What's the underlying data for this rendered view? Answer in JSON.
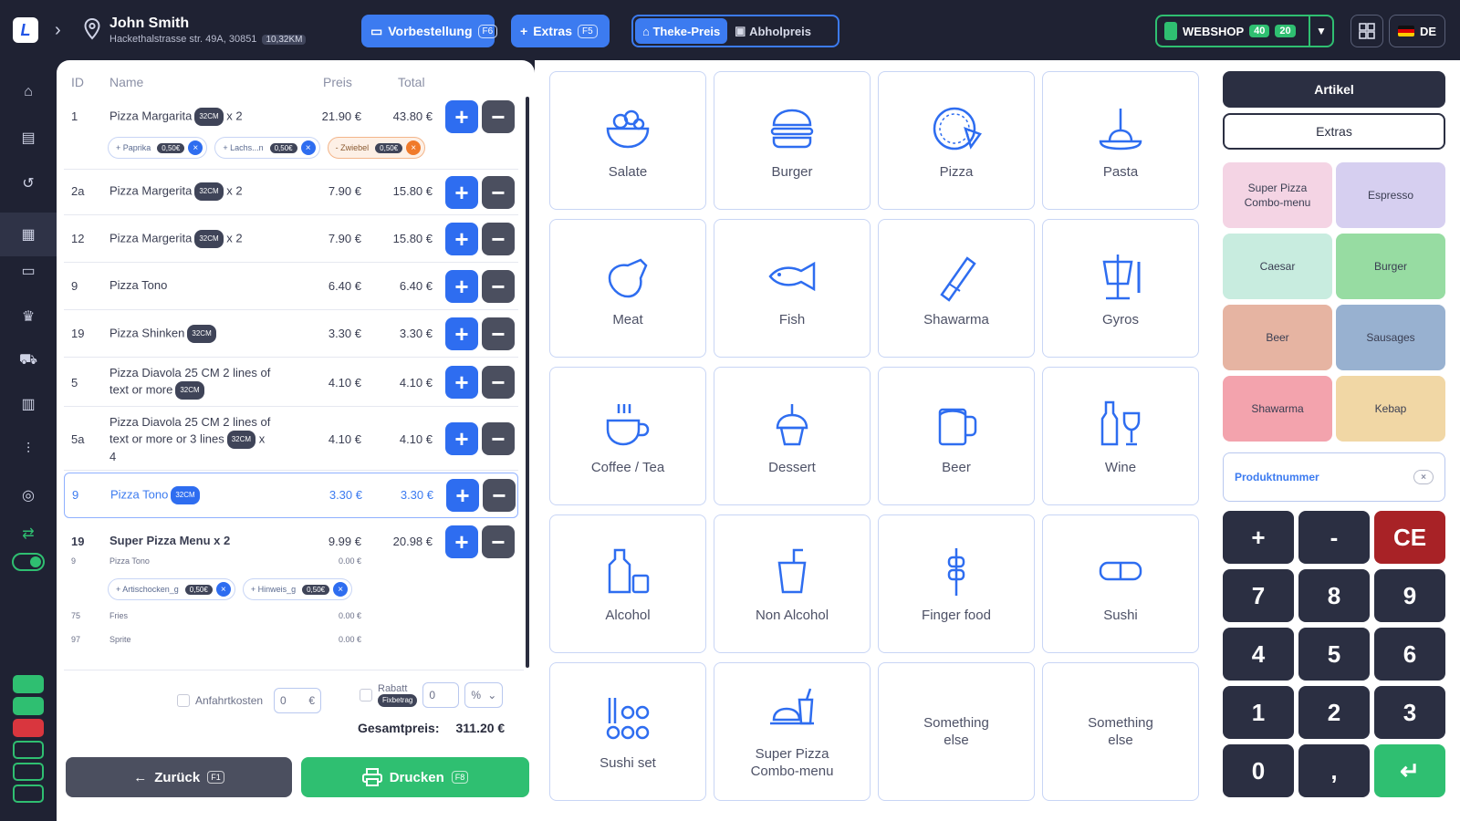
{
  "header": {
    "logo": "L",
    "customer_name": "John Smith",
    "customer_address": "Hackethalstrasse str. 49A, 30851",
    "customer_tag": "10,32KM",
    "btn_vorbestellung": "Vorbestellung",
    "btn_vorbestellung_key": "F6",
    "btn_extras": "Extras",
    "btn_extras_key": "F5",
    "seg_theke": "Theke-Preis",
    "seg_abholpreis": "Abholpreis",
    "webshop_label": "WEBSHOP",
    "webshop_count1": "40",
    "webshop_count2": "20",
    "language": "DE"
  },
  "table": {
    "col_id": "ID",
    "col_name": "Name",
    "col_price": "Preis",
    "col_total": "Total"
  },
  "rows": [
    {
      "id": "1",
      "name": "Pizza Margarita",
      "tag": "32CM",
      "qty": "x 2",
      "price": "21.90 €",
      "total": "43.80 €"
    },
    {
      "id": "2a",
      "name": "Pizza Margerita",
      "tag": "32CM",
      "qty": "x 2",
      "price": "7.90 €",
      "total": "15.80 €"
    },
    {
      "id": "12",
      "name": "Pizza Margerita",
      "tag": "32CM",
      "qty": "x 2",
      "price": "7.90 €",
      "total": "15.80 €"
    },
    {
      "id": "9",
      "name": "Pizza Tono",
      "tag": "",
      "qty": "",
      "price": "6.40 €",
      "total": "6.40 €"
    },
    {
      "id": "19",
      "name": "Pizza Shinken",
      "tag": "32CM",
      "qty": "",
      "price": "3.30 €",
      "total": "3.30 €"
    },
    {
      "id": "5",
      "name": "Pizza Diavola 25 CM 2 lines of text or more",
      "tag": "32CM",
      "qty": "",
      "price": "4.10 €",
      "total": "4.10 €"
    },
    {
      "id": "5a",
      "name": "Pizza Diavola 25 CM 2 lines of text or more or 3 lines",
      "tag": "32CM",
      "qty": "x 4",
      "price": "4.10 €",
      "total": "4.10 €"
    },
    {
      "id": "9",
      "name": "Pizza Tono",
      "tag": "32CM",
      "qty": "",
      "price": "3.30 €",
      "total": "3.30 €"
    },
    {
      "id": "19",
      "name": "Super Pizza Menu x 2",
      "tag": "",
      "qty": "",
      "price": "9.99 €",
      "total": "20.98 €"
    }
  ],
  "row1_chips": [
    {
      "label": "+ Paprika",
      "tag": "0,50€"
    },
    {
      "label": "+ Lachs...n",
      "tag": "0,50€"
    },
    {
      "label": "- Zwiebel",
      "tag": "0,50€"
    }
  ],
  "menu_subitems": [
    {
      "id": "9",
      "name": "Pizza Tono",
      "price": "0.00 €"
    },
    {
      "id": "75",
      "name": "Fries",
      "price": "0.00 €"
    },
    {
      "id": "97",
      "name": "Sprite",
      "price": "0.00 €"
    }
  ],
  "menu_chips": [
    {
      "label": "+ Artischocken_g",
      "tag": "0,50€"
    },
    {
      "label": "+ Hinweis_g",
      "tag": "0,50€"
    }
  ],
  "footer": {
    "anfahrt_label": "Anfahrtkosten",
    "anfahrt_value": "0",
    "anfahrt_unit": "€",
    "rabatt_label": "Rabatt",
    "rabatt_tag": "Fixbetrag",
    "rabatt_value": "0",
    "rabatt_unit": "%",
    "gesamt_label": "Gesamtpreis:",
    "gesamt_value": "311.20 €",
    "back_label": "Zurück",
    "back_key": "F1",
    "print_label": "Drucken",
    "print_key": "F8"
  },
  "categories": [
    {
      "label": "Salate",
      "icon": "salad-bowl-icon"
    },
    {
      "label": "Burger",
      "icon": "burger-icon"
    },
    {
      "label": "Pizza",
      "icon": "pizza-icon"
    },
    {
      "label": "Pasta",
      "icon": "pasta-plate-icon"
    },
    {
      "label": "Meat",
      "icon": "meat-leg-icon"
    },
    {
      "label": "Fish",
      "icon": "fish-icon"
    },
    {
      "label": "Shawarma",
      "icon": "shawarma-wrap-icon"
    },
    {
      "label": "Gyros",
      "icon": "gyros-spit-icon"
    },
    {
      "label": "Coffee / Tea",
      "icon": "coffee-cup-icon"
    },
    {
      "label": "Dessert",
      "icon": "cupcake-icon"
    },
    {
      "label": "Beer",
      "icon": "beer-mug-icon"
    },
    {
      "label": "Wine",
      "icon": "wine-bottle-glass-icon"
    },
    {
      "label": "Alcohol",
      "icon": "liquor-bottle-icon"
    },
    {
      "label": "Non Alcohol",
      "icon": "soft-drink-icon"
    },
    {
      "label": "Finger food",
      "icon": "skewer-icon"
    },
    {
      "label": "Sushi",
      "icon": "sushi-icon"
    },
    {
      "label": "Sushi set",
      "icon": "sushi-set-icon"
    },
    {
      "label": "Super Pizza\nCombo-menu",
      "icon": "combo-menu-icon"
    },
    {
      "label": "Something\nelse",
      "icon": ""
    },
    {
      "label": "Something\nelse",
      "icon": ""
    }
  ],
  "right": {
    "tab_artikel": "Artikel",
    "tab_extras": "Extras",
    "quick": [
      {
        "label": "Super Pizza\nCombo-menu",
        "color": "#f4d4e4"
      },
      {
        "label": "Espresso",
        "color": "#d6cff0"
      },
      {
        "label": "Caesar",
        "color": "#c8ecdf"
      },
      {
        "label": "Burger",
        "color": "#97dca2"
      },
      {
        "label": "Beer",
        "color": "#e6b4a2"
      },
      {
        "label": "Sausages",
        "color": "#98b1d0"
      },
      {
        "label": "Shawarma",
        "color": "#f3a3ad"
      },
      {
        "label": "Kebap",
        "color": "#f1d7a5"
      }
    ],
    "prodnum_placeholder": "Produktnummer",
    "keys": [
      "+",
      "-",
      "CE",
      "7",
      "8",
      "9",
      "4",
      "5",
      "6",
      "1",
      "2",
      "3",
      "0",
      ",",
      "↵"
    ]
  }
}
